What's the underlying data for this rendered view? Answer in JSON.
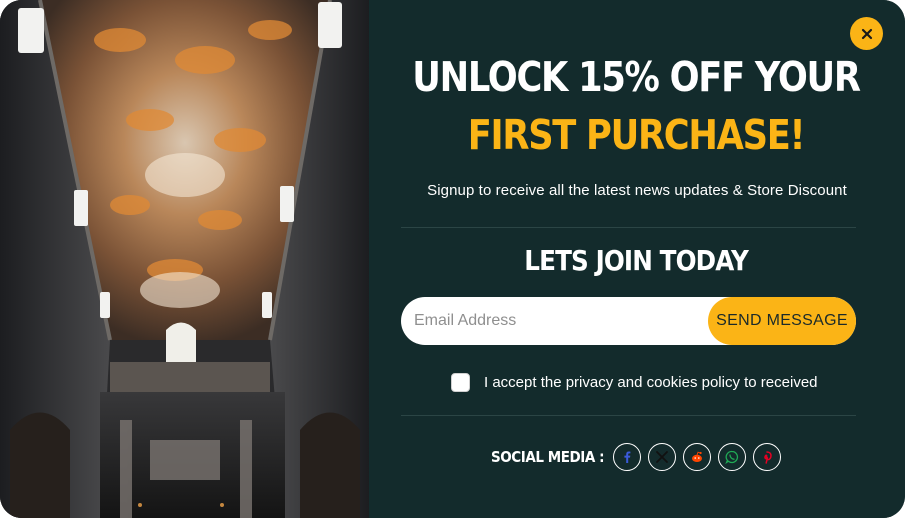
{
  "popup": {
    "headline_line1": "UNLOCK 15% OFF YOUR",
    "headline_line2": "FIRST PURCHASE!",
    "subtitle": "Signup to receive all the latest news updates & Store Discount",
    "join_title": "LETS JOIN TODAY",
    "email_placeholder": "Email Address",
    "send_label": "SEND MESSAGE",
    "consent_label": "I accept the privacy and cookies policy to received",
    "social_label": "SOCIAL MEDIA :",
    "close_icon": "close-icon",
    "hero_image": "painted-baroque-ceiling"
  },
  "social_icons": [
    {
      "name": "facebook-icon",
      "color": "#3b5bdb"
    },
    {
      "name": "x-icon",
      "color": "#111111"
    },
    {
      "name": "reddit-icon",
      "color": "#ff4500"
    },
    {
      "name": "whatsapp-icon",
      "color": "#1faa55"
    },
    {
      "name": "pinterest-icon",
      "color": "#e60023"
    }
  ],
  "colors": {
    "panel_background": "#132b2c",
    "accent": "#fbb416",
    "text": "#ffffff"
  }
}
